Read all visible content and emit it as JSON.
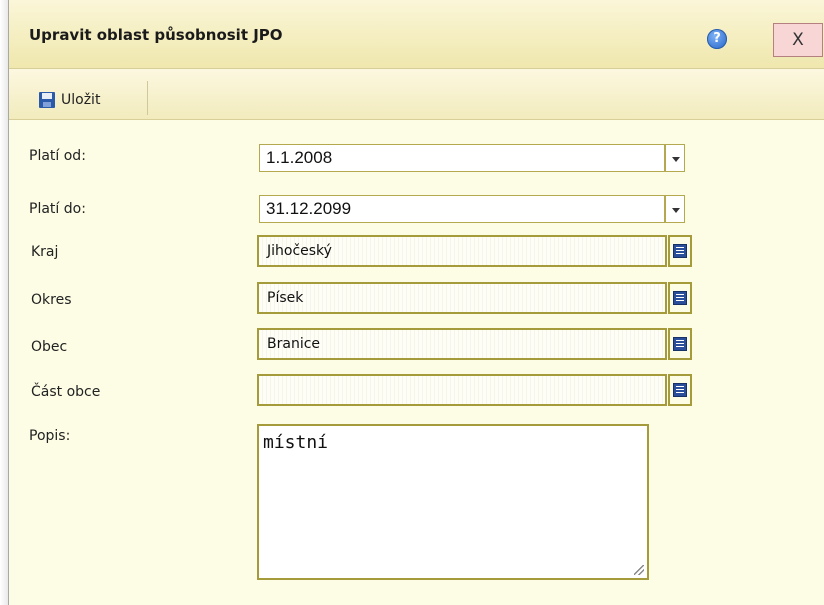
{
  "dialog": {
    "title": "Upravit oblast působnosit JPO",
    "help_icon": "?",
    "close_label": "X"
  },
  "toolbar": {
    "save_label": "Uložit",
    "save_icon": "floppy-disk-icon"
  },
  "form": {
    "plati_od": {
      "label": "Platí od:",
      "value": "1.1.2008"
    },
    "plati_do": {
      "label": "Platí do:",
      "value": "31.12.2099"
    },
    "kraj": {
      "label": "Kraj",
      "value": "Jihočeský"
    },
    "okres": {
      "label": "Okres",
      "value": "Písek"
    },
    "obec": {
      "label": "Obec",
      "value": "Branice"
    },
    "cast_obce": {
      "label": "Část obce",
      "value": ""
    },
    "popis": {
      "label": "Popis:",
      "value": "místní"
    }
  },
  "colors": {
    "background": "#fdfde6",
    "field_border": "#a69b3a",
    "close_bg": "#f8d6d6"
  }
}
